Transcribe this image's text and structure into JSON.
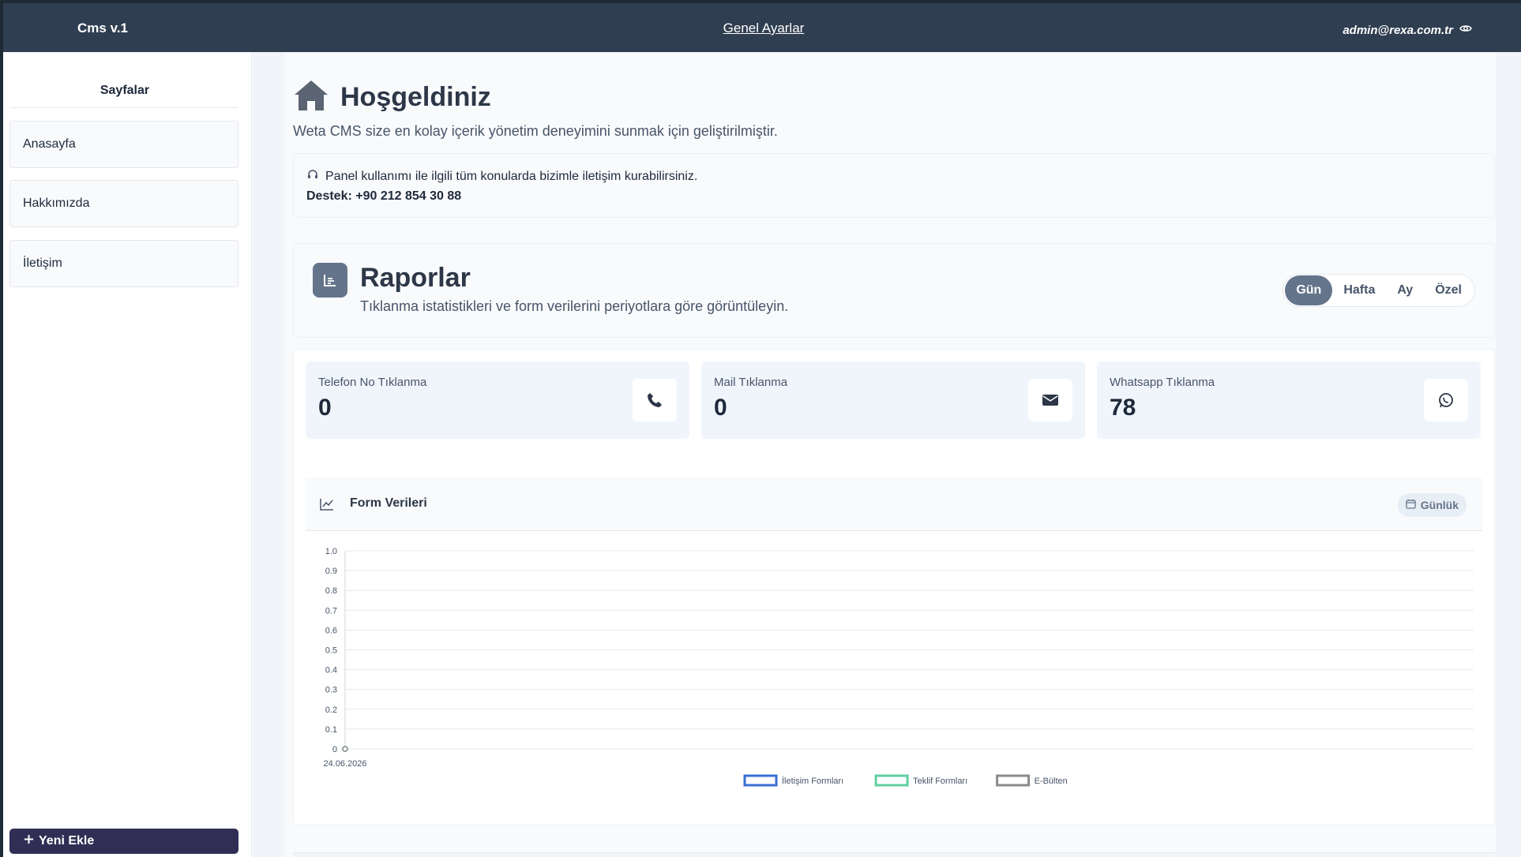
{
  "topbar": {
    "brand": "Cms v.1",
    "settings_link": "Genel Ayarlar",
    "user_email": "admin@rexa.com.tr",
    "user_icon": "eye-icon"
  },
  "sidebar": {
    "title": "Sayfalar",
    "items": [
      {
        "label": "Anasayfa"
      },
      {
        "label": "Hakkımızda"
      },
      {
        "label": "İletişim"
      }
    ],
    "new_button": "Yeni Ekle",
    "new_icon": "plus-icon"
  },
  "welcome": {
    "icon": "home-icon",
    "title": "Hoşgeldiniz",
    "subtitle": "Weta CMS size en kolay içerik yönetim deneyimini sunmak için geliştirilmiştir.",
    "support_icon": "headset-icon",
    "support_text": "Panel kullanımı ile ilgili tüm konularda bizimle iletişim kurabilirsiniz.",
    "support_phone": "Destek: +90 212 854 30 88"
  },
  "reports": {
    "icon": "report-icon",
    "title": "Raporlar",
    "subtitle": "Tıklanma istatistikleri ve form verilerini periyotlara göre görüntüleyin.",
    "periods": [
      "Gün",
      "Hafta",
      "Ay",
      "Özel"
    ],
    "active_period": "Gün",
    "active_color": "#64748b"
  },
  "stats": [
    {
      "label": "Telefon No Tıklanma",
      "value": "0",
      "icon": "phone-icon"
    },
    {
      "label": "Mail Tıklanma",
      "value": "0",
      "icon": "envelope-icon"
    },
    {
      "label": "Whatsapp Tıklanma",
      "value": "78",
      "icon": "whatsapp-icon"
    }
  ],
  "form_chart": {
    "title": "Form Verileri",
    "icon": "line-chart-icon",
    "badge": "Günlük",
    "badge_icon": "calendar-icon"
  },
  "chart_data": {
    "type": "line",
    "x": [
      "24.06.2026"
    ],
    "series": [
      {
        "name": "İletişim Formları",
        "values": [
          0
        ],
        "color": "#3b6fd4"
      },
      {
        "name": "Teklif Formları",
        "values": [
          0
        ],
        "color": "#5fcfa0"
      },
      {
        "name": "E-Bülten",
        "values": [
          0
        ],
        "color": "#8a8a8a"
      }
    ],
    "ylim": [
      0,
      1.0
    ],
    "yticks": [
      "1.0",
      "0.9",
      "0.8",
      "0.7",
      "0.6",
      "0.5",
      "0.4",
      "0.3",
      "0.2",
      "0.1",
      "0"
    ],
    "grid": true,
    "legend": "bottom"
  }
}
